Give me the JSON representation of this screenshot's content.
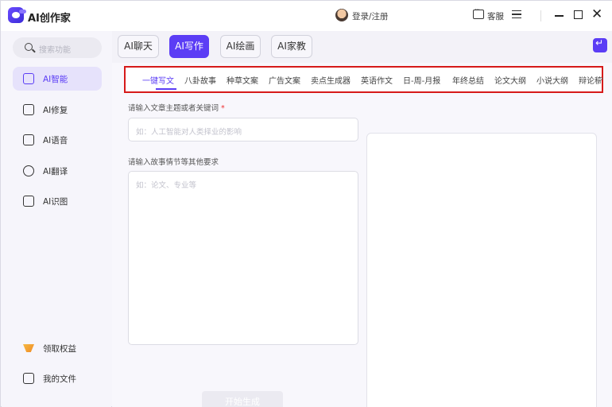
{
  "app": {
    "title": "AI创作家"
  },
  "header": {
    "login_label": "登录/注册",
    "service_label": "客服",
    "accent_color": "#5b3df5"
  },
  "sidebar": {
    "search_placeholder": "搜索功能",
    "items": [
      {
        "label": "AI智能",
        "icon": "ai-smart-icon",
        "active": true
      },
      {
        "label": "AI修复",
        "icon": "repair-icon"
      },
      {
        "label": "AI语音",
        "icon": "voice-icon"
      },
      {
        "label": "AI翻译",
        "icon": "translate-icon"
      },
      {
        "label": "AI识图",
        "icon": "image-recognition-icon"
      }
    ],
    "bottom_items": [
      {
        "label": "领取权益",
        "icon": "gift-icon"
      },
      {
        "label": "我的文件",
        "icon": "file-icon"
      }
    ]
  },
  "main": {
    "tabs": [
      {
        "label": "AI聊天"
      },
      {
        "label": "AI写作",
        "active": true
      },
      {
        "label": "AI绘画"
      },
      {
        "label": "AI家教"
      }
    ],
    "categories": [
      "一键写文",
      "八卦故事",
      "种草文案",
      "广告文案",
      "卖点生成器",
      "英语作文",
      "日-周-月报",
      "年终总结",
      "论文大纲",
      "小说大纲",
      "辩论稿"
    ],
    "active_category": "一键写文",
    "form": {
      "topic_label": "请输入文章主题或者关键词",
      "required_mark": "*",
      "topic_placeholder": "如：人工智能对人类择业的影响",
      "detail_label": "请输入故事情节等其他要求",
      "detail_placeholder": "如：论文、专业等",
      "generate_label": "开始生成"
    }
  }
}
